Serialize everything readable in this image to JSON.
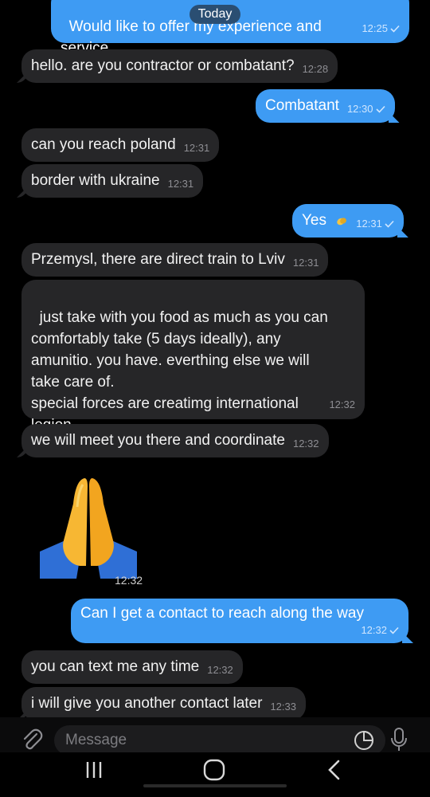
{
  "header": {
    "date_chip": "Today"
  },
  "messages": [
    {
      "text": "Would like to offer my experience and\nservice.",
      "time": "12:25"
    },
    {
      "text": "hello. are you contractor or combatant?",
      "time": "12:28"
    },
    {
      "text": "Combatant",
      "time": "12:30"
    },
    {
      "text": "can you reach poland",
      "time": "12:31"
    },
    {
      "text": "border with ukraine",
      "time": "12:31"
    },
    {
      "text": "Yes",
      "time": "12:31"
    },
    {
      "text": "Przemysl, there are direct train to Lviv",
      "time": "12:31"
    },
    {
      "text": "just take with you food as much as you can\ncomfortably take (5 days ideally), any\namunitio. you have. everthing else we will\ntake care of.\nspecial forces are creatimg international\nlegion",
      "time": "12:32"
    },
    {
      "text": "we will meet you there and coordinate",
      "time": "12:32"
    },
    {
      "text": "",
      "time": "12:32",
      "emoji": "folded-hands"
    },
    {
      "text": "Can I get a contact to reach along the way",
      "time": "12:32"
    },
    {
      "text": "you can text me any time",
      "time": "12:32"
    },
    {
      "text": "i will give you another contact later",
      "time": "12:33"
    }
  ],
  "composer": {
    "placeholder": "Message"
  },
  "colors": {
    "outgoing": "#3e9bf3",
    "incoming": "#262628",
    "background": "#000000"
  },
  "icons": {
    "attach": "paperclip-icon",
    "sticker": "sticker-icon",
    "mic": "microphone-icon",
    "nav_recent": "recent-apps-icon",
    "nav_home": "home-icon",
    "nav_back": "back-icon"
  }
}
